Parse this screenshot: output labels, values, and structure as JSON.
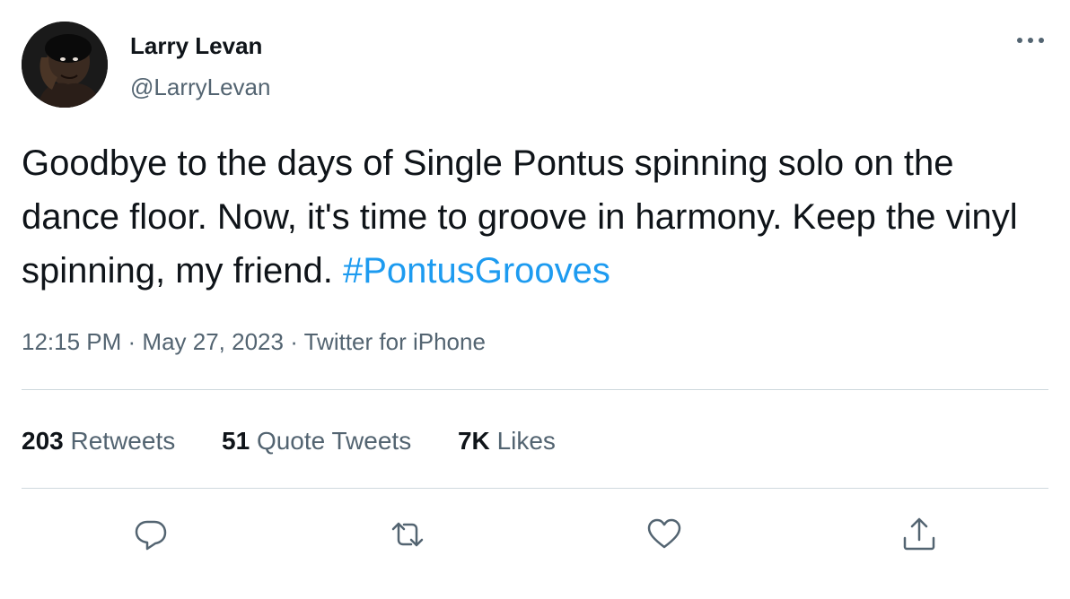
{
  "author": {
    "display_name": "Larry Levan",
    "handle": "@LarryLevan",
    "avatar_icon": "avatar-photo"
  },
  "tweet": {
    "text_before_hashtag": "Goodbye to the days of Single Pontus spinning solo on the dance floor. Now, it's time to groove in harmony. Keep the vinyl spinning, my friend. ",
    "hashtag": "#PontusGrooves",
    "time": "12:15 PM",
    "date": "May 27, 2023",
    "source": "Twitter for iPhone",
    "separator": " · "
  },
  "stats": {
    "retweets_count": "203",
    "retweets_label": "Retweets",
    "quotes_count": "51",
    "quotes_label": "Quote Tweets",
    "likes_count": "7K",
    "likes_label": "Likes"
  },
  "actions": [
    {
      "name": "reply",
      "icon": "reply-icon"
    },
    {
      "name": "retweet",
      "icon": "retweet-icon"
    },
    {
      "name": "like",
      "icon": "heart-icon"
    },
    {
      "name": "share",
      "icon": "share-icon"
    }
  ],
  "colors": {
    "text": "#0f1419",
    "secondary": "#536471",
    "accent": "#1d9bf0",
    "divider": "#cfd9de"
  }
}
